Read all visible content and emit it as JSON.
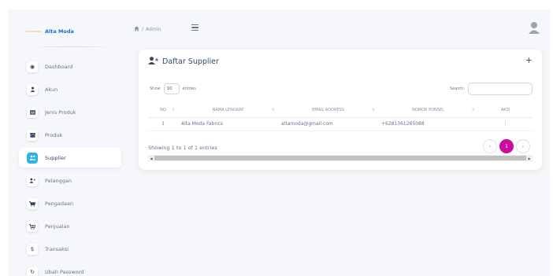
{
  "brand": {
    "logo_text": "•ALTA MODA",
    "name": "Alta Moda"
  },
  "breadcrumb": {
    "home_icon": "home-icon",
    "separator": "/",
    "current": "Admin"
  },
  "sidebar": {
    "items": [
      {
        "label": "Dashboard",
        "icon": "dashboard-icon",
        "glyph": "◉",
        "active": false
      },
      {
        "label": "Akun",
        "icon": "user-icon",
        "glyph": "👤",
        "active": false
      },
      {
        "label": "Jenis Produk",
        "icon": "category-icon",
        "glyph": "▤",
        "active": false
      },
      {
        "label": "Produk",
        "icon": "box-icon",
        "glyph": "▆",
        "active": false
      },
      {
        "label": "Supplier",
        "icon": "supplier-icon",
        "glyph": "👥",
        "active": true
      },
      {
        "label": "Pelanggan",
        "icon": "user-plus-icon",
        "glyph": "👤",
        "active": false
      },
      {
        "label": "Pengadaan",
        "icon": "cart-icon",
        "glyph": "🛒",
        "active": false
      },
      {
        "label": "Penjualan",
        "icon": "cart-plus-icon",
        "glyph": "🛒",
        "active": false
      },
      {
        "label": "Transaksi",
        "icon": "dollar-icon",
        "glyph": "$",
        "active": false
      },
      {
        "label": "Ubah Password",
        "icon": "refresh-icon",
        "glyph": "↻",
        "active": false
      }
    ]
  },
  "card": {
    "title": "Daftar Supplier",
    "add_label": "+",
    "length": {
      "prefix": "Show",
      "value": "10",
      "suffix": "entries"
    },
    "search": {
      "label": "Search:",
      "value": ""
    },
    "columns": [
      "NO",
      "NAMA LENGKAP",
      "EMAIL ADDRESS",
      "NOMOR PONSEL",
      "AKSI"
    ],
    "rows": [
      {
        "no": "1",
        "name": "Alta Moda Fabrics",
        "email": "altamoda@gmail.com",
        "phone": "+6281361265088",
        "action": "⋮"
      }
    ],
    "info": "Showing 1 to 1 of 1 entries",
    "pagination": {
      "prev": "‹",
      "current": "1",
      "next": "›"
    }
  }
}
